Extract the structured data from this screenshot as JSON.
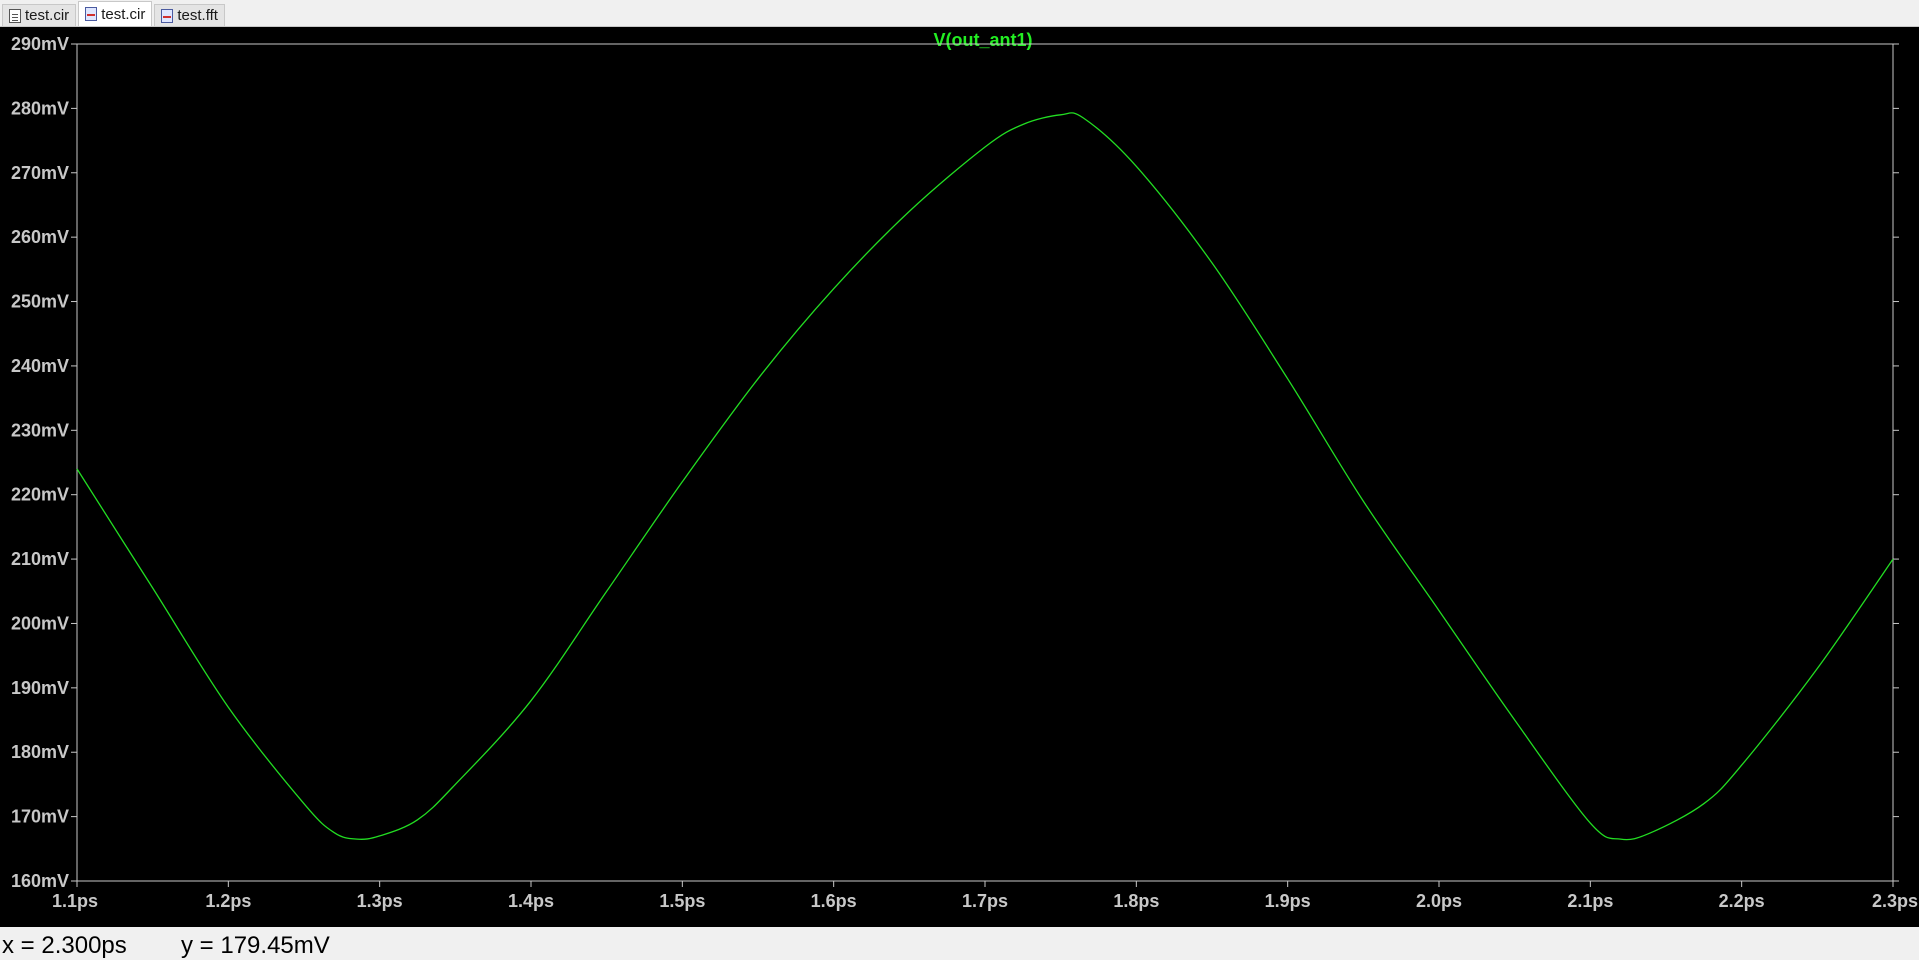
{
  "tabs": [
    {
      "label": "test.cir",
      "icon": "document-icon",
      "active": false
    },
    {
      "label": "test.cir",
      "icon": "waveform-icon",
      "active": true
    },
    {
      "label": "test.fft",
      "icon": "waveform-icon",
      "active": false
    }
  ],
  "colors": {
    "background": "#000000",
    "trace": "#22dd22",
    "title": "#22ee22",
    "axis_text": "#c8c8c8",
    "frame": "#c8c8c8"
  },
  "status": {
    "x_readout": "x = 2.300ps",
    "y_readout": "y = 179.45mV"
  },
  "chart_data": {
    "type": "line",
    "title": "V(out_ant1)",
    "xlabel": "",
    "ylabel": "",
    "x_unit": "ps",
    "y_unit": "mV",
    "xlim": [
      1.1,
      2.3
    ],
    "ylim": [
      160,
      290
    ],
    "x_ticks": [
      "1.1ps",
      "1.2ps",
      "1.3ps",
      "1.4ps",
      "1.5ps",
      "1.6ps",
      "1.7ps",
      "1.8ps",
      "1.9ps",
      "2.0ps",
      "2.1ps",
      "2.2ps",
      "2.3ps"
    ],
    "x_tick_values": [
      1.1,
      1.2,
      1.3,
      1.4,
      1.5,
      1.6,
      1.7,
      1.8,
      1.9,
      2.0,
      2.1,
      2.2,
      2.3
    ],
    "y_ticks": [
      "160mV",
      "170mV",
      "180mV",
      "190mV",
      "200mV",
      "210mV",
      "220mV",
      "230mV",
      "240mV",
      "250mV",
      "260mV",
      "270mV",
      "280mV",
      "290mV"
    ],
    "y_tick_values": [
      160,
      170,
      180,
      190,
      200,
      210,
      220,
      230,
      240,
      250,
      260,
      270,
      280,
      290
    ],
    "grid": false,
    "series": [
      {
        "x": [
          1.1,
          1.15,
          1.2,
          1.25,
          1.27,
          1.285,
          1.3,
          1.325,
          1.35,
          1.4,
          1.45,
          1.5,
          1.55,
          1.6,
          1.65,
          1.7,
          1.725,
          1.75,
          1.765,
          1.8,
          1.85,
          1.9,
          1.95,
          2.0,
          2.05,
          2.1,
          2.12,
          2.14,
          2.175,
          2.2,
          2.25,
          2.3
        ],
        "y": [
          224,
          205.5,
          187,
          172,
          167.5,
          166.5,
          167,
          169.5,
          175,
          188,
          205,
          222,
          238,
          252,
          264,
          274,
          277.5,
          279,
          278.5,
          271,
          256,
          238,
          219,
          202,
          185,
          169,
          166.5,
          167.5,
          172,
          178,
          193,
          210
        ]
      }
    ]
  }
}
